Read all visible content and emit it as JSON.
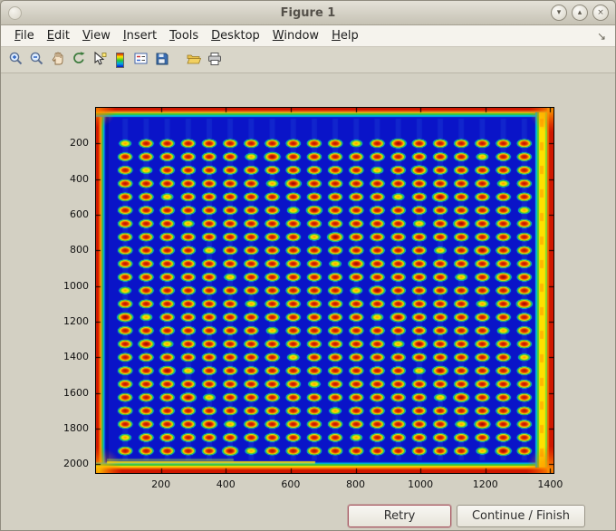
{
  "window": {
    "title": "Figure 1",
    "controls": {
      "minimize_glyph": "▾",
      "maximize_glyph": "▴",
      "close_glyph": "×"
    }
  },
  "menu": {
    "items": [
      {
        "label": "File"
      },
      {
        "label": "Edit"
      },
      {
        "label": "View"
      },
      {
        "label": "Insert"
      },
      {
        "label": "Tools"
      },
      {
        "label": "Desktop"
      },
      {
        "label": "Window"
      },
      {
        "label": "Help"
      }
    ],
    "overflow_glyph": "↘"
  },
  "toolbar": {
    "tools": [
      "zoom-in",
      "zoom-out",
      "pan",
      "rotate-3d",
      "data-cursor",
      "insert-colorbar",
      "insert-legend",
      "save-figure",
      "open-file",
      "print-figure"
    ]
  },
  "buttons": {
    "retry": "Retry",
    "continue_finish": "Continue / Finish"
  },
  "chart_data": {
    "type": "heatmap",
    "colormap": "jet",
    "title": "",
    "xlabel": "",
    "ylabel": "",
    "xlim": [
      0,
      1410
    ],
    "ylim": [
      0,
      2050
    ],
    "x_ticks": [
      200,
      400,
      600,
      800,
      1000,
      1200,
      1400
    ],
    "y_ticks": [
      200,
      400,
      600,
      800,
      1000,
      1200,
      1400,
      1600,
      1800,
      2000
    ],
    "grid": {
      "rows": 24,
      "cols": 20,
      "x_start": 90,
      "x_end": 1320,
      "y_start": 200,
      "y_end": 1926,
      "spot_rx": 25,
      "spot_ry": 27
    },
    "description": "Blue field (jet colormap) with a 24x20 grid of red/orange elliptical spots; hot red-orange borders on all edges and a yellow-green vertical band along the right edge."
  }
}
